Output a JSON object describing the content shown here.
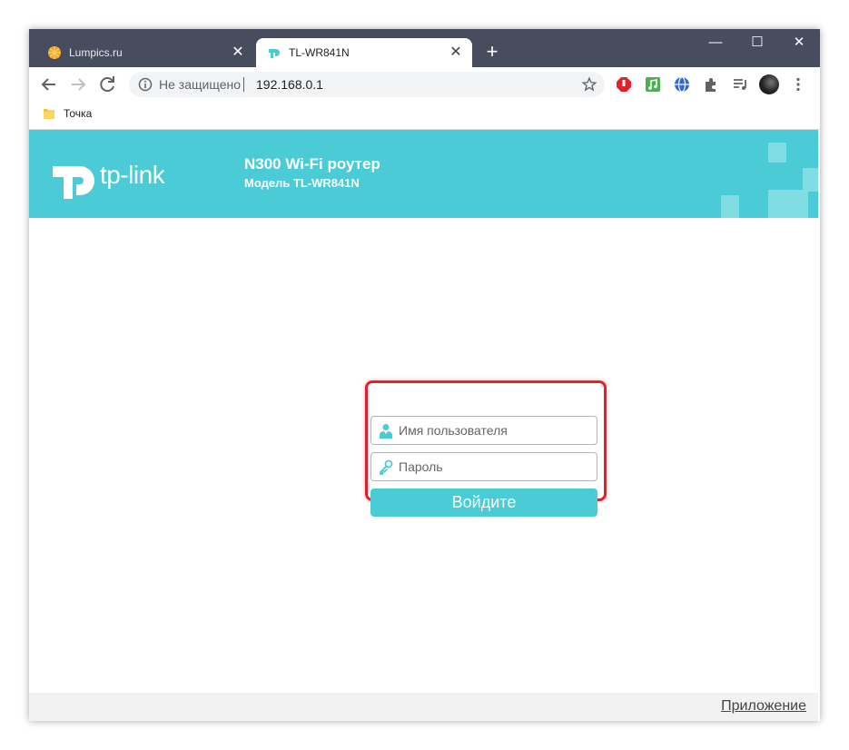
{
  "browser": {
    "tabs": [
      {
        "title": "Lumpics.ru",
        "active": false,
        "favicon": "orange-icon"
      },
      {
        "title": "TL-WR841N",
        "active": true,
        "favicon": "tplink-icon"
      }
    ],
    "tab_close_glyph": "✕",
    "new_tab_glyph": "+",
    "window_controls": {
      "minimize": "—",
      "maximize": "☐",
      "close": "✕"
    },
    "address": {
      "security_label": "Не защищено",
      "url": "192.168.0.1"
    },
    "bookmarks": [
      {
        "label": "Точка",
        "icon": "folder-icon"
      }
    ],
    "extensions": [
      "adblock-icon",
      "music-icon",
      "globe-icon",
      "puzzle-icon",
      "playlist-icon",
      "profile-avatar",
      "menu-dots-icon"
    ]
  },
  "page": {
    "logo_text": "tp-link",
    "model_title": "N300 Wi-Fi роутер",
    "model_subtitle": "Модель TL-WR841N",
    "login": {
      "username_placeholder": "Имя пользователя",
      "password_placeholder": "Пароль",
      "submit_label": "Войдите"
    },
    "footer_link": "Приложение"
  },
  "colors": {
    "brand": "#4acbd6",
    "highlight": "#e4212b",
    "tabstrip": "#474d5f"
  }
}
